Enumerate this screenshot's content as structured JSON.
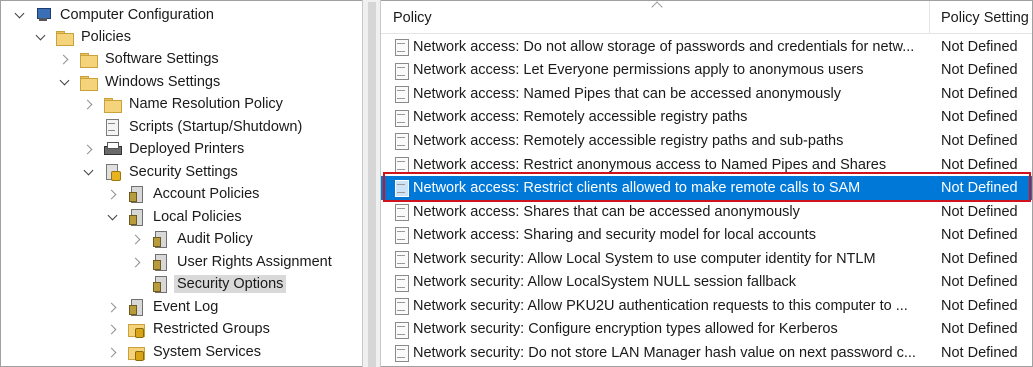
{
  "tree": {
    "items": [
      {
        "label": "Computer Configuration",
        "icon": "computer-icon",
        "expanded": true
      },
      {
        "label": "Policies",
        "icon": "folder-icon",
        "expanded": true
      },
      {
        "label": "Software Settings",
        "icon": "folder-icon",
        "expanded": false
      },
      {
        "label": "Windows Settings",
        "icon": "folder-icon",
        "expanded": true
      },
      {
        "label": "Name Resolution Policy",
        "icon": "folder-icon",
        "expanded": false
      },
      {
        "label": "Scripts (Startup/Shutdown)",
        "icon": "script-icon"
      },
      {
        "label": "Deployed Printers",
        "icon": "printer-icon",
        "expanded": false
      },
      {
        "label": "Security Settings",
        "icon": "security-settings-icon",
        "expanded": true
      },
      {
        "label": "Account Policies",
        "icon": "policy-icon",
        "expanded": false
      },
      {
        "label": "Local Policies",
        "icon": "policy-icon",
        "expanded": true
      },
      {
        "label": "Audit Policy",
        "icon": "policy-icon",
        "expanded": false
      },
      {
        "label": "User Rights Assignment",
        "icon": "policy-icon",
        "expanded": false
      },
      {
        "label": "Security Options",
        "icon": "policy-icon",
        "selected": true
      },
      {
        "label": "Event Log",
        "icon": "policy-icon",
        "expanded": false
      },
      {
        "label": "Restricted Groups",
        "icon": "restricted-groups-icon",
        "expanded": false
      },
      {
        "label": "System Services",
        "icon": "restricted-groups-icon",
        "expanded": false
      }
    ]
  },
  "list": {
    "columns": {
      "policy": "Policy",
      "setting": "Policy Setting"
    },
    "rows": [
      {
        "policy": "Network access: Do not allow storage of passwords and credentials for netw...",
        "setting": "Not Defined"
      },
      {
        "policy": "Network access: Let Everyone permissions apply to anonymous users",
        "setting": "Not Defined"
      },
      {
        "policy": "Network access: Named Pipes that can be accessed anonymously",
        "setting": "Not Defined"
      },
      {
        "policy": "Network access: Remotely accessible registry paths",
        "setting": "Not Defined"
      },
      {
        "policy": "Network access: Remotely accessible registry paths and sub-paths",
        "setting": "Not Defined"
      },
      {
        "policy": "Network access: Restrict anonymous access to Named Pipes and Shares",
        "setting": "Not Defined"
      },
      {
        "policy": "Network access: Restrict clients allowed to make remote calls to SAM",
        "setting": "Not Defined",
        "selected": true
      },
      {
        "policy": "Network access: Shares that can be accessed anonymously",
        "setting": "Not Defined"
      },
      {
        "policy": "Network access: Sharing and security model for local accounts",
        "setting": "Not Defined"
      },
      {
        "policy": "Network security: Allow Local System to use computer identity for NTLM",
        "setting": "Not Defined"
      },
      {
        "policy": "Network security: Allow LocalSystem NULL session fallback",
        "setting": "Not Defined"
      },
      {
        "policy": "Network security: Allow PKU2U authentication requests to this computer to ...",
        "setting": "Not Defined"
      },
      {
        "policy": "Network security: Configure encryption types allowed for Kerberos",
        "setting": "Not Defined"
      },
      {
        "policy": "Network security: Do not store LAN Manager hash value on next password c...",
        "setting": "Not Defined"
      }
    ]
  },
  "colors": {
    "selection": "#0078d7",
    "callout": "#d0121b",
    "tree_selection": "#d9d9d9"
  }
}
